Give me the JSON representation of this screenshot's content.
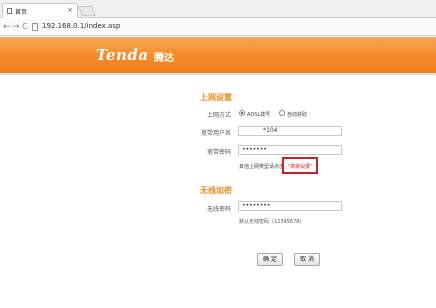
{
  "browser": {
    "tab_title": "首页",
    "tab_close": "×",
    "url": "192.168.0.1/index.asp",
    "back": "←",
    "forward": "→",
    "reload": "C"
  },
  "header": {
    "logo": "Tenda",
    "logo_cn": "腾达"
  },
  "internet": {
    "title": "上网设置",
    "mode_label": "上网方式",
    "mode_options": [
      "ADSL拨号",
      "自动获取"
    ],
    "mode_selected": "ADSL拨号",
    "user_label": "宽带用户名",
    "user_value": "*104",
    "pass_label": "宽带密码",
    "pass_value": "•••••••",
    "hint": "其他上网类型请点击",
    "adv_link": "\"高级设置\""
  },
  "wireless": {
    "title": "无线加密",
    "pass_label": "无线密码",
    "pass_value": "••••••••",
    "note": "默认无线密码（12345678）"
  },
  "buttons": {
    "ok": "确 定",
    "cancel": "取 消"
  },
  "colors": {
    "brand_orange": "#f58a28",
    "section_title": "#f08a1c",
    "highlight_red": "#cc1f1f"
  }
}
